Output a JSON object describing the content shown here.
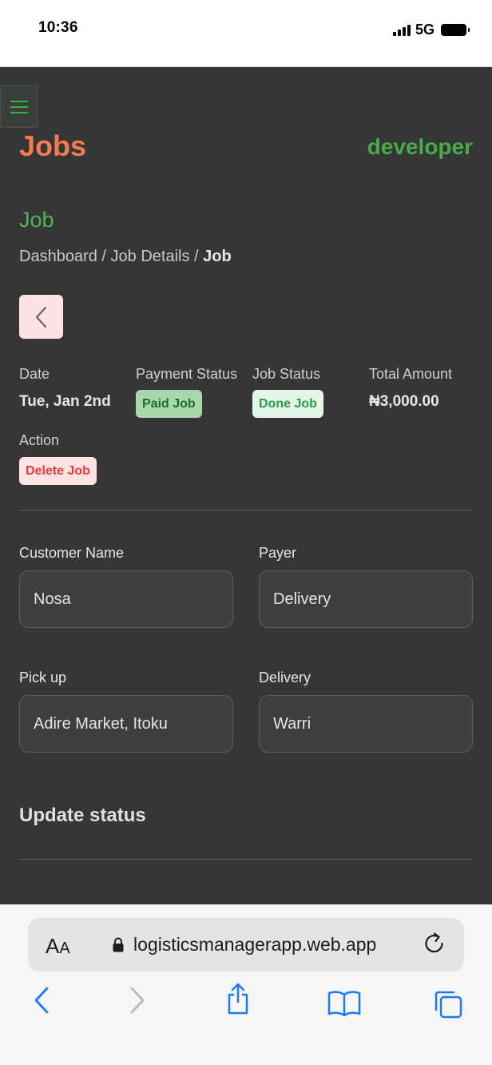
{
  "status_bar": {
    "time": "10:36",
    "network": "5G"
  },
  "header": {
    "title": "Jobs",
    "user": "developer"
  },
  "page": {
    "section_title": "Job"
  },
  "breadcrumb": {
    "part1": "Dashboard",
    "separator": " / ",
    "part2": "Job Details",
    "current": "Job"
  },
  "details": {
    "date_label": "Date",
    "date_value": "Tue, Jan 2nd",
    "payment_label": "Payment Status",
    "payment_badge": "Paid Job",
    "job_status_label": "Job Status",
    "job_status_badge": "Done Job",
    "amount_label": "Total Amount",
    "amount_value": "₦3,000.00",
    "action_label": "Action",
    "delete_label": "Delete Job"
  },
  "form": {
    "customer_label": "Customer Name",
    "customer_value": "Nosa",
    "payer_label": "Payer",
    "payer_value": "Delivery",
    "pickup_label": "Pick up",
    "pickup_value": "Adire Market, Itoku",
    "delivery_label": "Delivery",
    "delivery_value": "Warri"
  },
  "update": {
    "title": "Update status"
  },
  "browser": {
    "aa_big": "A",
    "aa_small": "A",
    "url": "logisticsmanagerapp.web.app"
  },
  "colors": {
    "accent_orange": "#f47a4f",
    "accent_green": "#46ac4a",
    "background": "#363636"
  }
}
